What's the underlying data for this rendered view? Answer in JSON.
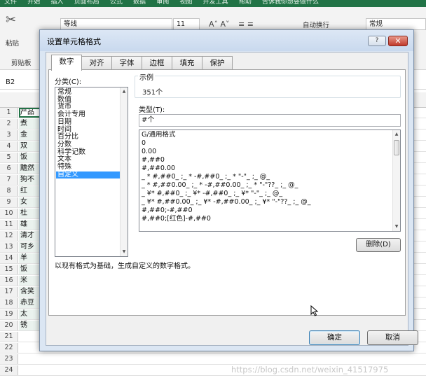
{
  "excel": {
    "ribbon_tabs": [
      "文件",
      "开始",
      "插入",
      "页面布局",
      "公式",
      "数据",
      "审阅",
      "视图",
      "开发工具",
      "帮助",
      "告诉我你想要做什么"
    ],
    "clipboard_label": "剪贴板",
    "paste_label": "粘贴",
    "font_name": "等线",
    "font_size": "11",
    "wrap_text": "自动换行",
    "number_format": "常规",
    "name_box": "B2",
    "rows": [
      {
        "num": "1",
        "text": "产品"
      },
      {
        "num": "2",
        "text": "煮"
      },
      {
        "num": "3",
        "text": "金"
      },
      {
        "num": "4",
        "text": "双"
      },
      {
        "num": "5",
        "text": "饭"
      },
      {
        "num": "6",
        "text": "黵然"
      },
      {
        "num": "7",
        "text": "狗不"
      },
      {
        "num": "8",
        "text": "红"
      },
      {
        "num": "9",
        "text": "女"
      },
      {
        "num": "10",
        "text": "杜"
      },
      {
        "num": "11",
        "text": "雄"
      },
      {
        "num": "12",
        "text": "清才"
      },
      {
        "num": "13",
        "text": "可乡"
      },
      {
        "num": "14",
        "text": "羊"
      },
      {
        "num": "15",
        "text": "饭"
      },
      {
        "num": "16",
        "text": "米"
      },
      {
        "num": "17",
        "text": "含笑"
      },
      {
        "num": "18",
        "text": "赤豆"
      },
      {
        "num": "19",
        "text": "太"
      },
      {
        "num": "20",
        "text": "锈"
      },
      {
        "num": "21",
        "text": ""
      },
      {
        "num": "22",
        "text": ""
      },
      {
        "num": "23",
        "text": ""
      },
      {
        "num": "24",
        "text": ""
      }
    ],
    "watermark": "https://blog.csdn.net/weixin_41517975"
  },
  "dialog": {
    "title": "设置单元格格式",
    "help_label": "?",
    "close_label": "✕",
    "tabs": [
      "数字",
      "对齐",
      "字体",
      "边框",
      "填充",
      "保护"
    ],
    "active_tab": "数字",
    "category_label": "分类(C):",
    "categories": [
      "常规",
      "数值",
      "货币",
      "会计专用",
      "日期",
      "时间",
      "百分比",
      "分数",
      "科学记数",
      "文本",
      "特殊",
      "自定义"
    ],
    "selected_category": "自定义",
    "sample_label": "示例",
    "sample_value": "351个",
    "type_label": "类型(T):",
    "type_value": "#个",
    "formats": [
      "G/通用格式",
      "0",
      "0.00",
      "#,##0",
      "#,##0.00",
      "_ * #,##0_ ;_ * -#,##0_ ;_ * \"-\"_ ;_ @_",
      "_ * #,##0.00_ ;_ * -#,##0.00_ ;_ * \"-\"??_ ;_ @_",
      "_ ¥* #,##0_ ;_ ¥* -#,##0_ ;_ ¥* \"-\"_ ;_ @_",
      "_ ¥* #,##0.00_ ;_ ¥* -#,##0.00_ ;_ ¥* \"-\"??_ ;_ @_",
      "#,##0;-#,##0",
      "#,##0;[红色]-#,##0"
    ],
    "delete_label": "删除(D)",
    "description": "以现有格式为基础，生成自定义的数字格式。",
    "ok_label": "确定",
    "cancel_label": "取消"
  },
  "colors": {
    "excel_green": "#217346",
    "selection_blue": "#3399ff",
    "dialog_frame": "#dbe6f3"
  }
}
